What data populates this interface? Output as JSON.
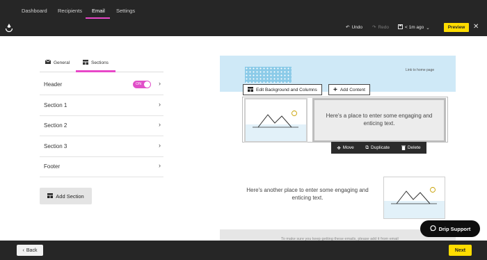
{
  "nav": {
    "items": [
      "Dashboard",
      "Recipients",
      "Email",
      "Settings"
    ],
    "active": "Email"
  },
  "toolbar": {
    "undo": "Undo",
    "redo": "Redo",
    "saved": "< 1m ago",
    "preview": "Preview"
  },
  "panel": {
    "tabs": [
      "General",
      "Sections"
    ],
    "active_tab": "Sections",
    "rows": [
      {
        "label": "Header",
        "toggle": "ON"
      },
      {
        "label": "Section 1"
      },
      {
        "label": "Section 2"
      },
      {
        "label": "Section 3"
      },
      {
        "label": "Footer"
      }
    ],
    "add_section": "Add Section"
  },
  "email": {
    "home_link": "Link to home page",
    "header_buttons": {
      "edit": "Edit Background and Columns",
      "add": "Add Content"
    },
    "text1": "Here's a place to enter some engaging and enticing text.",
    "actions": {
      "move": "Move",
      "duplicate": "Duplicate",
      "delete": "Delete"
    },
    "text2": "Here's another place to enter some engaging and enticing text.",
    "footer_note": "To make sure you keep getting these emails, please add it from email"
  },
  "support": "Drip Support",
  "footer": {
    "back": "Back",
    "next": "Next"
  },
  "colors": {
    "accent": "#e848c8",
    "cta": "#ffdd00",
    "dark": "#262626"
  }
}
